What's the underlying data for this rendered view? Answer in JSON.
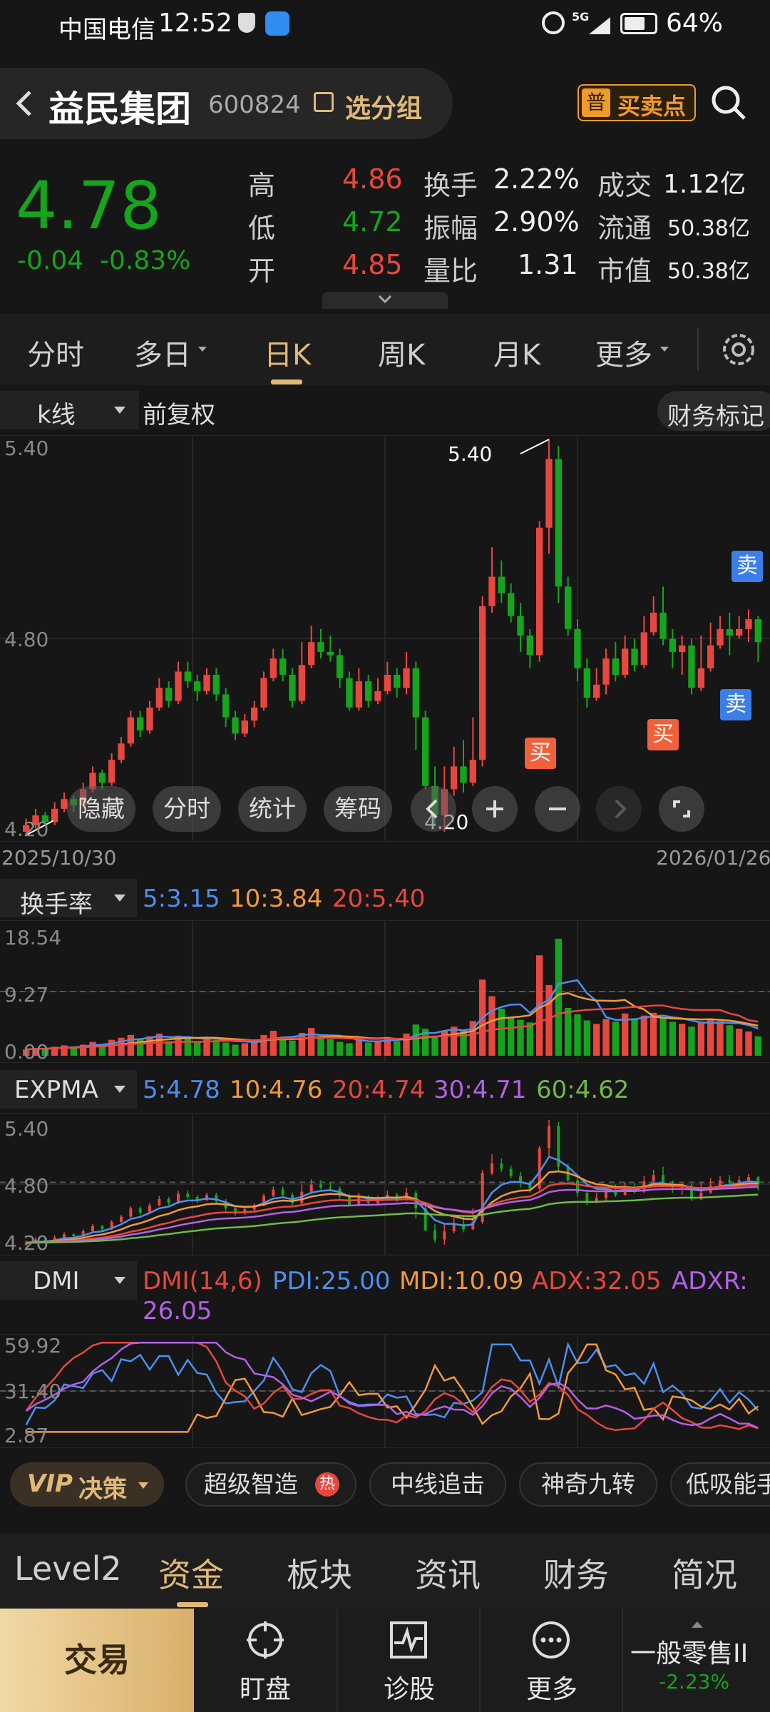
{
  "status": {
    "carrier": "中国电信",
    "time": "12:52",
    "battery": "64%",
    "net": "5G"
  },
  "header": {
    "back_icon": "chevron-left-icon",
    "name": "益民集团",
    "code": "600824",
    "group_label": "选分组",
    "badge_pre": "普",
    "badge_label": "买卖点",
    "search_icon": "search-icon"
  },
  "quote": {
    "price": "4.78",
    "change": "-0.04",
    "pct": "-0.83%",
    "high_label": "高",
    "high": "4.86",
    "low_label": "低",
    "low": "4.72",
    "open_label": "开",
    "open": "4.85",
    "turnover_label": "换手",
    "turnover": "2.22%",
    "amp_label": "振幅",
    "amp": "2.90%",
    "vr_label": "量比",
    "vr": "1.31",
    "vol_label": "成交",
    "vol": "1.12亿",
    "float_label": "流通",
    "float": "50.38亿",
    "mcap_label": "市值",
    "mcap": "50.38亿"
  },
  "tabs": {
    "t1": "分时",
    "t2": "多日",
    "t3": "日K",
    "t4": "周K",
    "t5": "月K",
    "t6": "更多",
    "active": "日K"
  },
  "kline": {
    "type_label": "k线",
    "adjust_label": "前复权",
    "finance_label": "财务标记",
    "y_top": "5.40",
    "y_mid": "4.80",
    "y_bot": "4.20",
    "hi_label": "5.40",
    "lo_label": "4.20",
    "date_start": "2025/10/30",
    "date_end": "2026/01/26",
    "buy": "买",
    "sell": "卖",
    "tool_hide": "隐藏",
    "tool_fenshi": "分时",
    "tool_stats": "统计",
    "tool_chips": "筹码"
  },
  "turnover": {
    "label": "换手率",
    "ma5": "5:3.15",
    "ma10": "10:3.84",
    "ma20": "20:5.40",
    "y_top": "18.54",
    "y_mid": "9.27",
    "y_bot": "0.00"
  },
  "expma": {
    "label": "EXPMA",
    "e5": "5:4.78",
    "e10": "10:4.76",
    "e20": "20:4.74",
    "e30": "30:4.71",
    "e60": "60:4.62",
    "y_top": "5.40",
    "y_mid": "4.80",
    "y_bot": "4.20"
  },
  "dmi": {
    "label": "DMI",
    "p": "DMI(14,6)",
    "pdi": "PDI:25.00",
    "mdi": "MDI:10.09",
    "adx": "ADX:32.05",
    "adxr_a": "ADXR:",
    "adxr_b": "26.05",
    "y_top": "59.92",
    "y_mid": "31.40",
    "y_bot": "2.87"
  },
  "strategy": {
    "vip": "VIP",
    "decision": "决策",
    "c1": "超级智造",
    "hot": "热",
    "c2": "中线追击",
    "c3": "神奇九转",
    "c4": "低吸能手"
  },
  "bottom_tabs": {
    "b1": "Level2",
    "b2": "资金",
    "b3": "板块",
    "b4": "资讯",
    "b5": "财务",
    "b6": "简况",
    "active": "资金"
  },
  "bottom": {
    "trade": "交易",
    "watch": "盯盘",
    "diag": "诊股",
    "more": "更多",
    "sector": "一般零售II",
    "sector_pct": "-2.23%"
  },
  "colors": {
    "up": "#e8473f",
    "down": "#15a51c",
    "blue": "#4b8ff0",
    "orange": "#f29a3a",
    "purple": "#b560e8",
    "gold": "#e0b979"
  },
  "chart_data": {
    "type": "candlestick",
    "x_start": "2025/10/30",
    "x_end": "2026/01/26",
    "ylim": [
      4.2,
      5.4
    ],
    "candles": [
      [
        4.2,
        4.22,
        4.24,
        4.19
      ],
      [
        4.22,
        4.25,
        4.27,
        4.21
      ],
      [
        4.25,
        4.23,
        4.26,
        4.22
      ],
      [
        4.23,
        4.27,
        4.29,
        4.22
      ],
      [
        4.27,
        4.3,
        4.32,
        4.26
      ],
      [
        4.3,
        4.28,
        4.31,
        4.26
      ],
      [
        4.28,
        4.33,
        4.35,
        4.27
      ],
      [
        4.33,
        4.38,
        4.4,
        4.32
      ],
      [
        4.38,
        4.35,
        4.39,
        4.33
      ],
      [
        4.35,
        4.42,
        4.44,
        4.34
      ],
      [
        4.42,
        4.47,
        4.49,
        4.41
      ],
      [
        4.47,
        4.55,
        4.57,
        4.46
      ],
      [
        4.55,
        4.51,
        4.57,
        4.49
      ],
      [
        4.51,
        4.58,
        4.6,
        4.5
      ],
      [
        4.58,
        4.64,
        4.67,
        4.57
      ],
      [
        4.64,
        4.6,
        4.66,
        4.58
      ],
      [
        4.6,
        4.69,
        4.72,
        4.59
      ],
      [
        4.69,
        4.66,
        4.72,
        4.64
      ],
      [
        4.66,
        4.63,
        4.68,
        4.6
      ],
      [
        4.63,
        4.68,
        4.7,
        4.62
      ],
      [
        4.68,
        4.62,
        4.7,
        4.6
      ],
      [
        4.62,
        4.55,
        4.64,
        4.52
      ],
      [
        4.55,
        4.5,
        4.57,
        4.48
      ],
      [
        4.5,
        4.54,
        4.56,
        4.49
      ],
      [
        4.54,
        4.58,
        4.6,
        4.52
      ],
      [
        4.58,
        4.67,
        4.69,
        4.57
      ],
      [
        4.67,
        4.73,
        4.76,
        4.66
      ],
      [
        4.73,
        4.68,
        4.76,
        4.66
      ],
      [
        4.68,
        4.6,
        4.7,
        4.58
      ],
      [
        4.6,
        4.71,
        4.78,
        4.59
      ],
      [
        4.71,
        4.78,
        4.83,
        4.7
      ],
      [
        4.78,
        4.75,
        4.82,
        4.73
      ],
      [
        4.75,
        4.74,
        4.8,
        4.72
      ],
      [
        4.74,
        4.67,
        4.76,
        4.64
      ],
      [
        4.67,
        4.58,
        4.69,
        4.57
      ],
      [
        4.58,
        4.66,
        4.7,
        4.57
      ],
      [
        4.66,
        4.6,
        4.68,
        4.58
      ],
      [
        4.6,
        4.63,
        4.67,
        4.59
      ],
      [
        4.63,
        4.68,
        4.72,
        4.62
      ],
      [
        4.68,
        4.64,
        4.7,
        4.61
      ],
      [
        4.64,
        4.7,
        4.75,
        4.62
      ],
      [
        4.7,
        4.55,
        4.72,
        4.45
      ],
      [
        4.55,
        4.34,
        4.57,
        4.33
      ],
      [
        4.34,
        4.25,
        4.4,
        4.22
      ],
      [
        4.25,
        4.33,
        4.4,
        4.2
      ],
      [
        4.33,
        4.4,
        4.46,
        4.31
      ],
      [
        4.4,
        4.35,
        4.48,
        4.32
      ],
      [
        4.35,
        4.42,
        4.55,
        4.34
      ],
      [
        4.42,
        4.89,
        4.92,
        4.4
      ],
      [
        4.89,
        4.98,
        5.07,
        4.87
      ],
      [
        4.98,
        4.93,
        5.03,
        4.9
      ],
      [
        4.93,
        4.86,
        4.96,
        4.84
      ],
      [
        4.86,
        4.8,
        4.9,
        4.75
      ],
      [
        4.8,
        4.74,
        4.82,
        4.7
      ],
      [
        4.74,
        5.13,
        5.15,
        4.72
      ],
      [
        5.13,
        5.34,
        5.4,
        5.05
      ],
      [
        5.34,
        4.95,
        5.38,
        4.9
      ],
      [
        4.95,
        4.82,
        4.98,
        4.8
      ],
      [
        4.82,
        4.7,
        4.85,
        4.66
      ],
      [
        4.7,
        4.61,
        4.73,
        4.58
      ],
      [
        4.61,
        4.65,
        4.7,
        4.6
      ],
      [
        4.65,
        4.73,
        4.76,
        4.62
      ],
      [
        4.73,
        4.68,
        4.78,
        4.66
      ],
      [
        4.68,
        4.76,
        4.8,
        4.67
      ],
      [
        4.76,
        4.71,
        4.79,
        4.69
      ],
      [
        4.71,
        4.81,
        4.86,
        4.7
      ],
      [
        4.81,
        4.87,
        4.92,
        4.8
      ],
      [
        4.87,
        4.79,
        4.95,
        4.77
      ],
      [
        4.79,
        4.75,
        4.82,
        4.7
      ],
      [
        4.75,
        4.77,
        4.8,
        4.68
      ],
      [
        4.77,
        4.64,
        4.79,
        4.62
      ],
      [
        4.64,
        4.7,
        4.8,
        4.63
      ],
      [
        4.7,
        4.77,
        4.84,
        4.69
      ],
      [
        4.77,
        4.82,
        4.86,
        4.76
      ],
      [
        4.82,
        4.8,
        4.87,
        4.74
      ],
      [
        4.8,
        4.82,
        4.86,
        4.79
      ],
      [
        4.82,
        4.85,
        4.88,
        4.78
      ],
      [
        4.85,
        4.78,
        4.86,
        4.72
      ]
    ],
    "turnover": [
      0.9,
      1.1,
      1.0,
      1.3,
      1.5,
      1.2,
      1.6,
      2.0,
      1.7,
      2.3,
      2.6,
      3.0,
      2.4,
      2.8,
      3.2,
      2.1,
      2.9,
      2.5,
      2.0,
      2.7,
      2.3,
      1.9,
      1.6,
      1.8,
      2.2,
      3.0,
      3.6,
      2.6,
      2.2,
      3.3,
      4.0,
      2.8,
      2.4,
      2.0,
      1.8,
      2.4,
      1.9,
      2.2,
      2.7,
      2.1,
      3.2,
      4.5,
      3.9,
      2.8,
      3.6,
      4.2,
      3.8,
      5.0,
      11.0,
      8.6,
      6.8,
      5.5,
      5.2,
      4.8,
      14.5,
      10.2,
      16.9,
      6.9,
      6.0,
      5.1,
      4.6,
      5.3,
      4.9,
      6.1,
      5.4,
      5.8,
      6.2,
      5.5,
      4.9,
      4.6,
      4.2,
      4.8,
      5.3,
      5.0,
      4.4,
      3.9,
      3.5,
      2.8
    ]
  }
}
